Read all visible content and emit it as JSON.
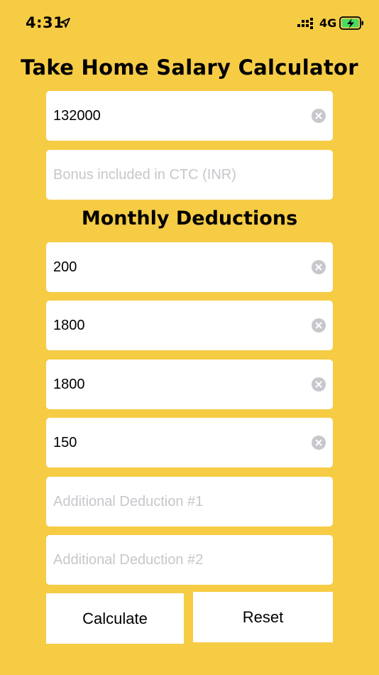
{
  "status_bar": {
    "time": "4:31",
    "network": "4G",
    "icons": [
      "location-arrow-icon",
      "signal-icon",
      "battery-charging-icon"
    ]
  },
  "title": "Take Home Salary Calculator",
  "ctc_field": {
    "value": "132000",
    "placeholder": ""
  },
  "bonus_field": {
    "value": "",
    "placeholder": "Bonus included in CTC (INR)"
  },
  "deductions_title": "Monthly Deductions",
  "deductions": [
    {
      "value": "200",
      "placeholder": ""
    },
    {
      "value": "1800",
      "placeholder": ""
    },
    {
      "value": "1800",
      "placeholder": ""
    },
    {
      "value": "150",
      "placeholder": ""
    },
    {
      "value": "",
      "placeholder": "Additional Deduction #1"
    },
    {
      "value": "",
      "placeholder": "Additional Deduction #2"
    }
  ],
  "buttons": {
    "calculate": "Calculate",
    "reset": "Reset"
  },
  "colors": {
    "background": "#F6CC45",
    "field_bg": "#FFFFFF",
    "placeholder": "#C7C7CC",
    "clear_icon": "#C7C7CC",
    "battery_charge": "#4CD964"
  }
}
